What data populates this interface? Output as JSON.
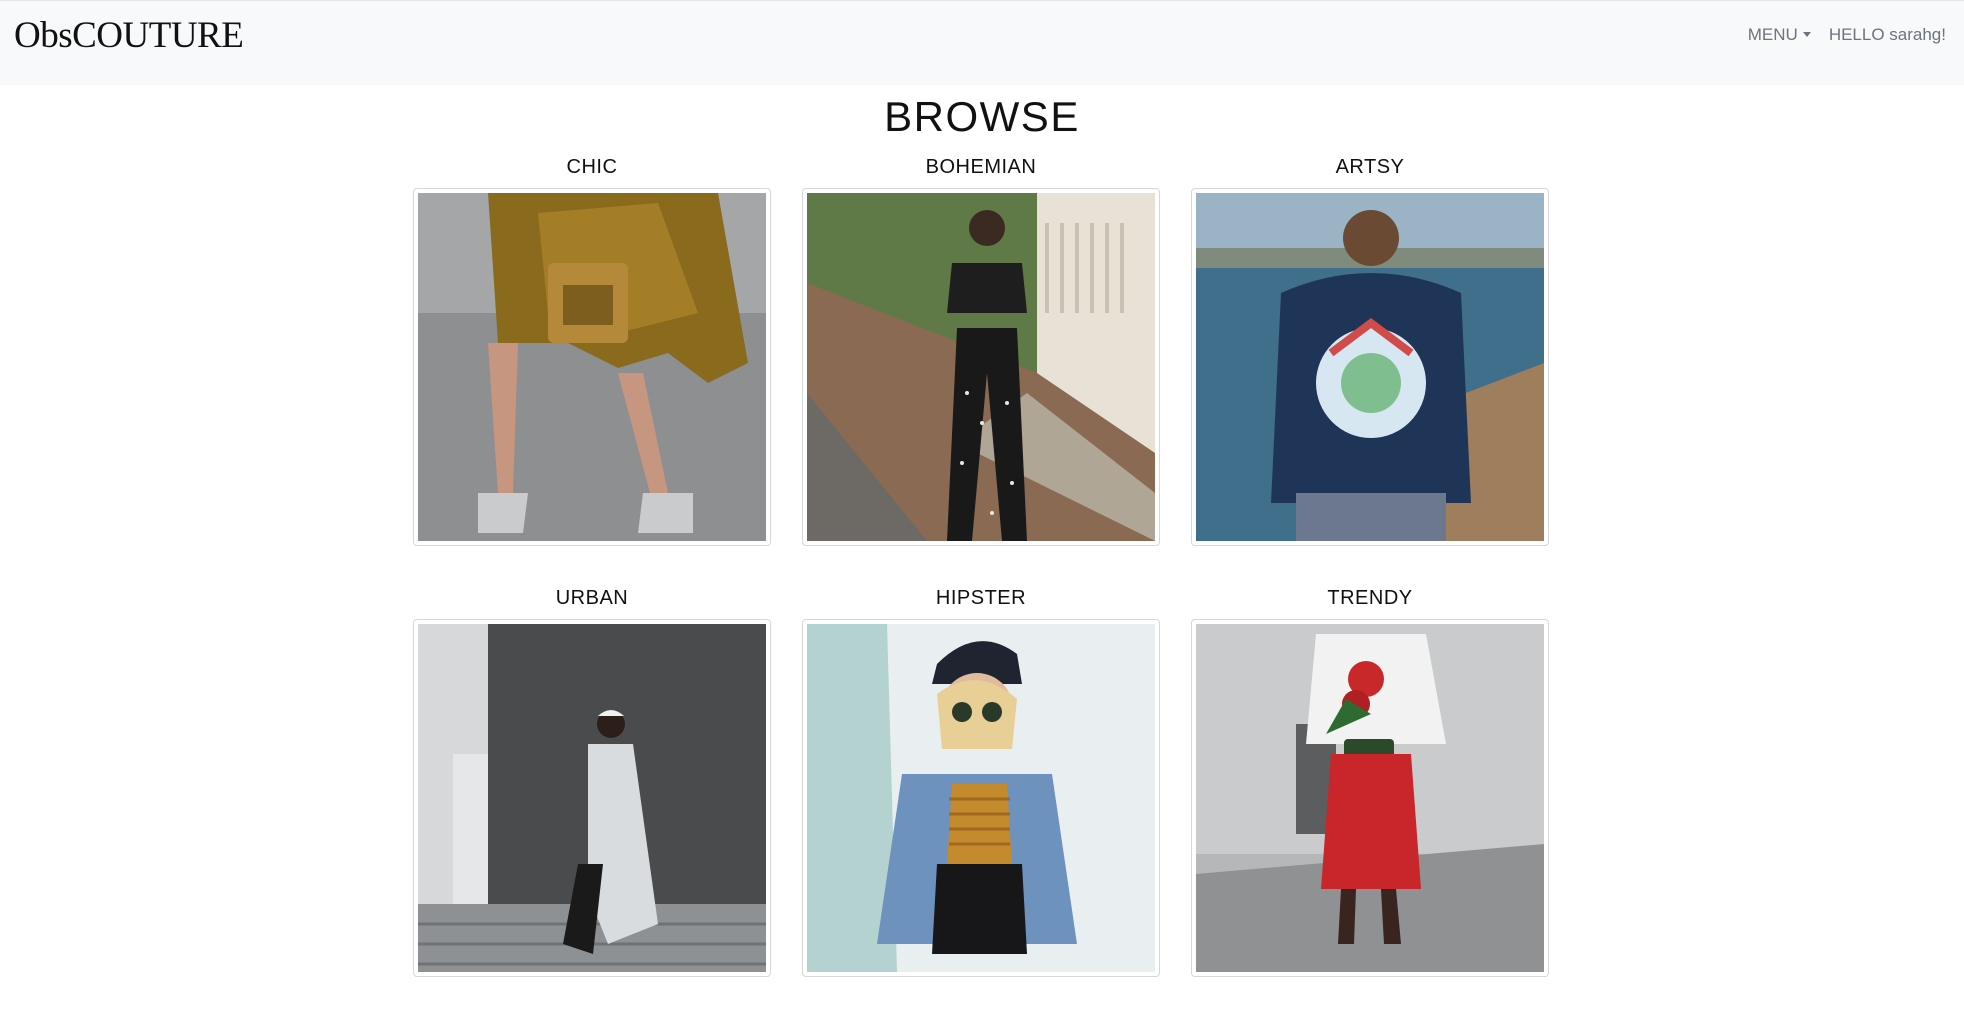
{
  "navbar": {
    "brand": "ObsCOUTURE",
    "menu_label": "MENU",
    "greeting": "HELLO sarahg!"
  },
  "page": {
    "title": "BROWSE"
  },
  "styles": [
    {
      "label": "CHIC",
      "icon": "chic-photo"
    },
    {
      "label": "BOHEMIAN",
      "icon": "bohemian-photo"
    },
    {
      "label": "ARTSY",
      "icon": "artsy-photo"
    },
    {
      "label": "URBAN",
      "icon": "urban-photo"
    },
    {
      "label": "HIPSTER",
      "icon": "hipster-photo"
    },
    {
      "label": "TRENDY",
      "icon": "trendy-photo"
    }
  ],
  "colors": {
    "navbar_bg": "#f8f9fa",
    "nav_text": "#6c757d",
    "title_text": "#111111"
  }
}
